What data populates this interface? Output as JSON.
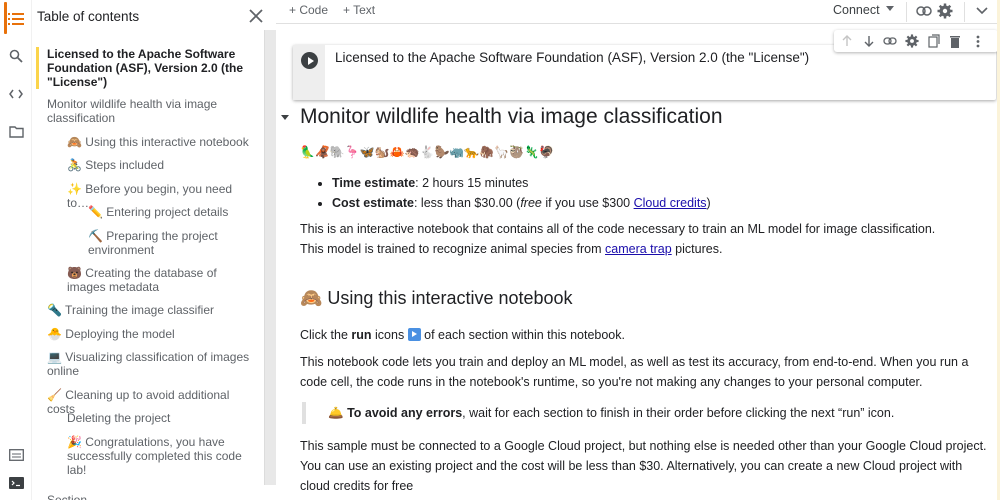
{
  "rail": {
    "icons": [
      "table-of-contents-icon",
      "search-icon",
      "code-snippets-icon",
      "files-icon",
      "command-palette-icon",
      "terminal-icon"
    ]
  },
  "toc": {
    "title": "Table of contents",
    "items": [
      {
        "label": "Licensed to the Apache Software Foundation (ASF), Version 2.0 (the \"License\")",
        "level": 1,
        "current": true
      },
      {
        "label": "Monitor wildlife health via image classification",
        "level": 1
      },
      {
        "label": "🙈 Using this interactive notebook",
        "level": 2
      },
      {
        "label": "🚴 Steps included",
        "level": 2
      },
      {
        "label": "✨ Before you begin, you need to…",
        "level": 2
      },
      {
        "label": "✏️ Entering project details",
        "level": 3
      },
      {
        "label": "⛏️ Preparing the project environment",
        "level": 3
      },
      {
        "label": "🐻 Creating the database of images metadata",
        "level": 2
      },
      {
        "label": "🔦 Training the image classifier",
        "level": 1
      },
      {
        "label": "🐣 Deploying the model",
        "level": 1
      },
      {
        "label": "💻 Visualizing classification of images online",
        "level": 1
      },
      {
        "label": "🧹 Cleaning up to avoid additional costs",
        "level": 1
      },
      {
        "label": "Deleting the project",
        "level": 2
      },
      {
        "label": "🎉 Congratulations, you have successfully completed this code lab!",
        "level": 2
      },
      {
        "label": "Section",
        "level": 1
      }
    ]
  },
  "toolbar": {
    "add_code": "+ Code",
    "add_text": "+ Text",
    "connect": "Connect"
  },
  "cell_toolbar": {
    "icons": [
      "move-up-icon",
      "move-down-icon",
      "link-icon",
      "settings-icon",
      "mirror-cell-icon",
      "delete-icon",
      "more-icon"
    ]
  },
  "notebook": {
    "license_cell": "Licensed to the Apache Software Foundation (ASF), Version 2.0 (the \"License\")",
    "heading": "Monitor wildlife health via image classification",
    "emoji_row": "🦜🦧🐘🦩🦋🐿️🦀🦔🐇🦫🦏🐆🦣🦙🦥🦎🦃",
    "bullets": [
      {
        "label": "Time estimate",
        "text": ": 2 hours 15 minutes"
      },
      {
        "label": "Cost estimate",
        "text_before": ": less than $30.00 (",
        "italic": "free",
        "text_mid": " if you use $300 ",
        "link": "Cloud credits",
        "text_after": ")"
      }
    ],
    "intro_1": "This is an interactive notebook that contains all of the code necessary to train an ML model for image classification.",
    "intro_2_before": "This model is trained to recognize animal species from ",
    "intro_2_link": "camera trap",
    "intro_2_after": " pictures.",
    "section_heading": "🙈 Using this interactive notebook",
    "click_before": "Click the ",
    "click_bold": "run",
    "click_mid": " icons ",
    "click_after": " of each section within this notebook.",
    "para_runtime": "This notebook code lets you train and deploy an ML model, as well as test its accuracy, from end-to-end. When you run a code cell, the code runs in the notebook's runtime, so you're not making any changes to your personal computer.",
    "quote_emoji": "🛎️",
    "quote_bold": "To avoid any errors",
    "quote_text": ", wait for each section to finish in their order before clicking the next “run” icon.",
    "para_project": "This sample must be connected to a Google Cloud project, but nothing else is needed other than your Google Cloud project. You can use an existing project and the cost will be less than $30. Alternatively, you can create a new Cloud project with cloud credits for free"
  }
}
